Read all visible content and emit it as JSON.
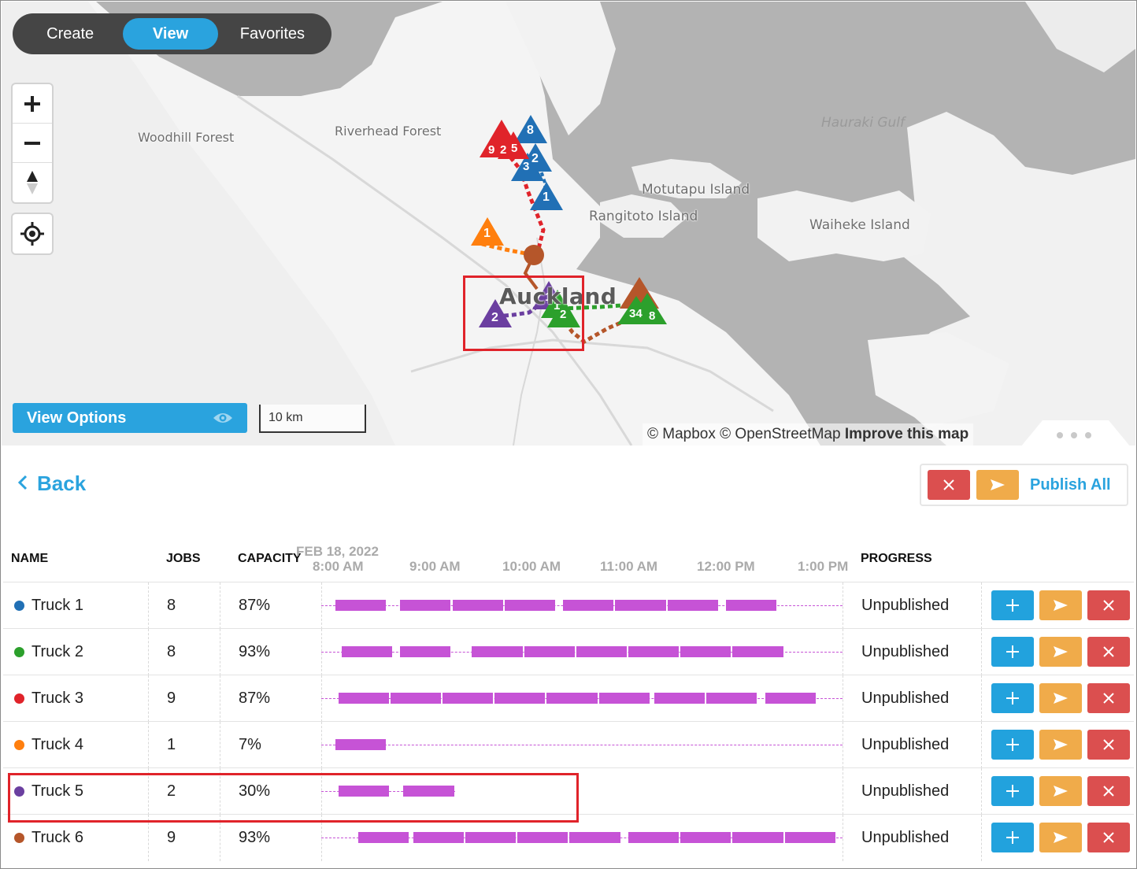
{
  "mode_switch": {
    "create": "Create",
    "view": "View",
    "favorites": "Favorites"
  },
  "map_controls": {
    "zoom_in_icon": "plus-icon",
    "zoom_out_icon": "minus-icon",
    "compass_icon": "compass-icon",
    "locate_icon": "locate-icon"
  },
  "map": {
    "labels": {
      "woodhill": "Woodhill Forest",
      "riverhead": "Riverhead Forest",
      "hauraki": "Hauraki Gulf",
      "motutapu": "Motutapu Island",
      "rangitoto": "Rangitoto Island",
      "waiheke": "Waiheke Island",
      "auckland": "Auckland"
    },
    "markers": {
      "blue_8": "8",
      "blue_2": "2",
      "blue_3": "3",
      "blue_1": "1",
      "red_9": "9",
      "red_2": "2",
      "red_5": "5",
      "orange_1": "1",
      "purple_2": "2",
      "purple_1": "1",
      "green_1": "1",
      "green_2": "2",
      "cluster_34": "34",
      "cluster_8": "8"
    },
    "route_colors": {
      "truck1": "#2170b5",
      "truck2": "#2ca02c",
      "truck3": "#e0232a",
      "truck4": "#ff7f0e",
      "truck5": "#6b3fa0",
      "truck6": "#b5562a"
    },
    "scale": "10 km",
    "attribution": {
      "mapbox": "© Mapbox",
      "osm": "© OpenStreetMap",
      "improve": "Improve this map"
    }
  },
  "view_options": {
    "label": "View Options",
    "icon": "eye-icon"
  },
  "panel": {
    "back": "Back",
    "publish_all": "Publish All",
    "header": {
      "name": "NAME",
      "jobs": "JOBS",
      "capacity": "CAPACITY",
      "progress": "PROGRESS",
      "date": "FEB 18, 2022",
      "times": [
        "8:00 AM",
        "9:00 AM",
        "10:00 AM",
        "11:00 AM",
        "12:00 PM",
        "1:00 PM"
      ]
    },
    "rows": [
      {
        "name": "Truck 1",
        "color": "#2170b5",
        "jobs": "8",
        "capacity": "87%",
        "progress": "Unpublished",
        "timeline": {
          "start": "8:00",
          "end": "1:00",
          "jobs": [
            [
              "8:08",
              "8:40"
            ],
            [
              "8:48",
              "9:20"
            ],
            [
              "9:20",
              "9:52"
            ],
            [
              "9:52",
              "10:24"
            ],
            [
              "10:28",
              "11:00"
            ],
            [
              "11:00",
              "11:32"
            ],
            [
              "11:32",
              "12:04"
            ],
            [
              "12:08",
              "12:40"
            ]
          ]
        }
      },
      {
        "name": "Truck 2",
        "color": "#2ca02c",
        "jobs": "8",
        "capacity": "93%",
        "progress": "Unpublished",
        "timeline": {
          "start": "8:00",
          "end": "1:00",
          "jobs": [
            [
              "8:12",
              "8:44"
            ],
            [
              "8:48",
              "9:20"
            ],
            [
              "9:32",
              "10:04"
            ],
            [
              "10:04",
              "10:36"
            ],
            [
              "10:36",
              "11:08"
            ],
            [
              "11:08",
              "11:40"
            ],
            [
              "11:40",
              "12:12"
            ],
            [
              "12:12",
              "12:44"
            ]
          ]
        }
      },
      {
        "name": "Truck 3",
        "color": "#e0232a",
        "jobs": "9",
        "capacity": "87%",
        "progress": "Unpublished",
        "timeline": {
          "start": "8:00",
          "end": "1:00",
          "jobs": [
            [
              "8:10",
              "8:42"
            ],
            [
              "8:42",
              "9:14"
            ],
            [
              "9:14",
              "9:46"
            ],
            [
              "9:46",
              "10:18"
            ],
            [
              "10:18",
              "10:50"
            ],
            [
              "10:50",
              "11:22"
            ],
            [
              "11:24",
              "11:56"
            ],
            [
              "11:56",
              "12:28"
            ],
            [
              "12:32",
              "13:04"
            ]
          ]
        }
      },
      {
        "name": "Truck 4",
        "color": "#ff7f0e",
        "jobs": "1",
        "capacity": "7%",
        "progress": "Unpublished",
        "timeline": {
          "start": "8:00",
          "end": "1:00",
          "jobs": [
            [
              "8:08",
              "8:40"
            ]
          ]
        }
      },
      {
        "name": "Truck 5",
        "color": "#6b3fa0",
        "jobs": "2",
        "capacity": "30%",
        "progress": "Unpublished",
        "timeline": {
          "start": "8:00",
          "end": "9:00",
          "jobs": [
            [
              "8:10",
              "8:42"
            ],
            [
              "8:50",
              "9:22"
            ]
          ]
        }
      },
      {
        "name": "Truck 6",
        "color": "#b5562a",
        "jobs": "9",
        "capacity": "93%",
        "progress": "Unpublished",
        "timeline": {
          "start": "8:00",
          "end": "1:00",
          "jobs": [
            [
              "8:22",
              "8:54"
            ],
            [
              "8:56",
              "9:28"
            ],
            [
              "9:28",
              "10:00"
            ],
            [
              "10:00",
              "10:32"
            ],
            [
              "10:32",
              "11:04"
            ],
            [
              "11:08",
              "11:40"
            ],
            [
              "11:40",
              "12:12"
            ],
            [
              "12:12",
              "12:44"
            ],
            [
              "12:44",
              "13:16"
            ]
          ]
        }
      }
    ]
  }
}
